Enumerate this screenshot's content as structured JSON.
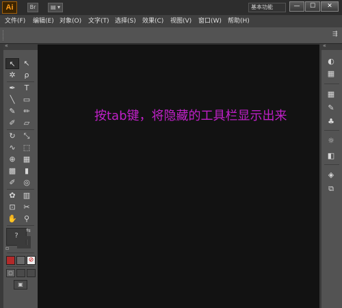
{
  "app": {
    "logo": "Ai",
    "workspace": "基本功能"
  },
  "titlebar_icons": {
    "bridge": "Br",
    "arrange": "▤ ▾"
  },
  "window_buttons": {
    "minimize": "—",
    "maximize": "☐",
    "close": "✕"
  },
  "menu": [
    "文件(F)",
    "编辑(E)",
    "对象(O)",
    "文字(T)",
    "选择(S)",
    "效果(C)",
    "视图(V)",
    "窗口(W)",
    "帮助(H)"
  ],
  "hint_text": "按tab键，将隐藏的工具栏显示出来",
  "tools": {
    "selection": "↖",
    "direct_selection": "↖",
    "magic_wand": "✲",
    "lasso": "ρ",
    "pen": "✒",
    "type": "T",
    "line": "╲",
    "rectangle": "▭",
    "paintbrush": "✎",
    "pencil": "✏",
    "blob_brush": "✐",
    "eraser": "▱",
    "rotate": "↻",
    "scale": "⤡",
    "warp": "∿",
    "free_transform": "⬚",
    "shape_builder": "⊕",
    "perspective": "▦",
    "mesh": "▩",
    "gradient": "▮",
    "eyedropper": "✐",
    "blend": "◎",
    "symbol_sprayer": "✿",
    "graph": "▥",
    "artboard": "⊡",
    "slice": "✂",
    "hand": "✋",
    "zoom": "⚲",
    "fill_stroke": "?",
    "swap": "⇆",
    "default": "▫",
    "color": "■",
    "gradient_mode": "■",
    "none_mode": "⊘",
    "draw_mode": "▢",
    "screen_mode": "▣"
  },
  "right_panel": {
    "appearance": "◐",
    "graphic_styles": "▦",
    "brushes": "✎",
    "symbols": "♣",
    "stroke": "☼",
    "transparency": "◧",
    "layers": "◈",
    "artboards": "⧉"
  },
  "colors": {
    "hint": "#c020c8",
    "canvas": "#121212",
    "panel": "#535353"
  }
}
